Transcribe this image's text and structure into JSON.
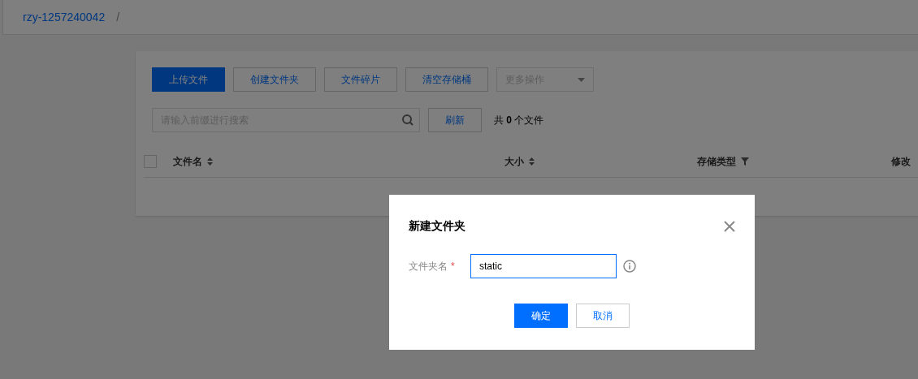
{
  "breadcrumb": {
    "bucket": "rzy-1257240042",
    "separator": "/"
  },
  "toolbar": {
    "buttons": [
      {
        "label": "上传文件",
        "kind": "primary"
      },
      {
        "label": "创建文件夹",
        "kind": "default"
      },
      {
        "label": "文件碎片",
        "kind": "default"
      },
      {
        "label": "清空存储桶",
        "kind": "default"
      }
    ],
    "more_dropdown": {
      "label": "更多操作",
      "disabled": true
    }
  },
  "search": {
    "placeholder": "请输入前缀进行搜索"
  },
  "refresh_button": "刷新",
  "file_count": {
    "prefix": "共",
    "count": "0",
    "suffix": "个文件"
  },
  "table": {
    "columns": [
      {
        "label": "文件名",
        "kind": "sort"
      },
      {
        "label": "大小",
        "kind": "sort"
      },
      {
        "label": "存储类型",
        "kind": "filter"
      },
      {
        "label": "修改",
        "kind": "plain"
      }
    ],
    "select_all_checked": false
  },
  "dialog": {
    "title": "新建文件夹",
    "field": {
      "label": "文件夹名",
      "required_mark": "*",
      "value": "static"
    },
    "buttons": [
      {
        "label": "确定",
        "kind": "primary"
      },
      {
        "label": "取消",
        "kind": "default"
      }
    ]
  }
}
